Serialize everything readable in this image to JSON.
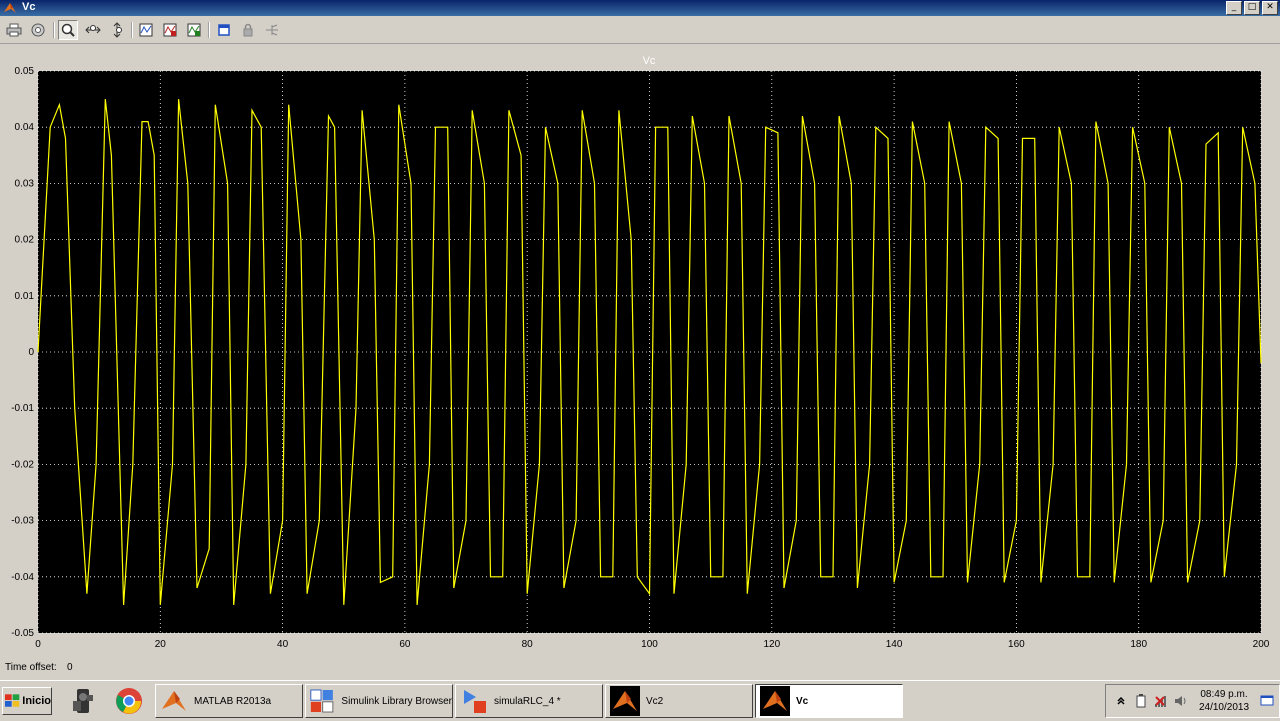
{
  "window": {
    "title": "Vc"
  },
  "plot": {
    "title": "Vc",
    "colors": {
      "background": "#000000",
      "grid": "#ffffff",
      "line": "#ffff00",
      "axes": "#ffffff"
    }
  },
  "chart_data": {
    "type": "line",
    "title": "Vc",
    "xlabel": "",
    "ylabel": "",
    "xlim": [
      0,
      200
    ],
    "ylim": [
      -0.05,
      0.05
    ],
    "grid": true,
    "x_ticks": [
      "0",
      "20",
      "40",
      "60",
      "80",
      "100",
      "120",
      "140",
      "160",
      "180",
      "200"
    ],
    "y_ticks": [
      "0.05",
      "0.04",
      "0.03",
      "0.02",
      "0.01",
      "0",
      "-0.01",
      "-0.02",
      "-0.03",
      "-0.04",
      "-0.05"
    ],
    "series": [
      {
        "color": "#ffff00",
        "x": [
          0,
          2,
          3.5,
          4.5,
          6,
          8,
          9.5,
          11,
          12,
          14,
          15.5,
          17,
          18,
          19,
          20,
          22,
          23,
          24.5,
          26,
          28,
          29,
          31,
          32,
          34,
          35,
          36.5,
          38,
          40,
          41,
          43,
          44,
          46,
          47.5,
          48.5,
          50,
          52,
          53,
          55,
          56,
          58,
          59,
          61,
          62,
          64,
          65,
          67,
          68,
          70,
          71,
          73,
          74,
          76,
          77,
          79,
          80,
          82,
          83,
          85,
          86,
          88,
          89,
          91,
          92,
          94,
          95,
          97,
          98,
          100,
          101,
          103,
          104,
          106,
          107,
          109,
          110,
          112,
          113,
          115,
          116,
          118,
          119,
          121,
          122,
          124,
          125,
          127,
          128,
          130,
          131,
          133,
          134,
          136,
          137,
          139,
          140,
          142,
          143,
          145,
          146,
          148,
          149,
          151,
          152,
          154,
          155,
          157,
          158,
          160,
          161,
          163,
          164,
          166,
          167,
          169,
          170,
          172,
          173,
          175,
          176,
          178,
          179,
          181,
          182,
          184,
          185,
          187,
          188,
          190,
          191,
          193,
          194,
          196,
          197,
          199,
          200
        ],
        "y": [
          0,
          0.04,
          0.044,
          0.038,
          -0.01,
          -0.043,
          -0.02,
          0.045,
          0.035,
          -0.045,
          -0.02,
          0.041,
          0.041,
          0.035,
          -0.045,
          -0.02,
          0.045,
          0.03,
          -0.042,
          -0.035,
          0.044,
          0.03,
          -0.045,
          -0.02,
          0.043,
          0.04,
          -0.043,
          -0.03,
          0.044,
          0.02,
          -0.043,
          -0.03,
          0.042,
          0.04,
          -0.045,
          -0.01,
          0.043,
          0.02,
          -0.041,
          -0.04,
          0.044,
          0.03,
          -0.045,
          -0.02,
          0.04,
          0.04,
          -0.042,
          -0.03,
          0.043,
          0.03,
          -0.04,
          -0.04,
          0.043,
          0.035,
          -0.043,
          -0.02,
          0.04,
          0.03,
          -0.042,
          -0.03,
          0.043,
          0.03,
          -0.04,
          -0.04,
          0.043,
          0.02,
          -0.04,
          -0.043,
          0.04,
          0.04,
          -0.043,
          -0.02,
          0.042,
          0.03,
          -0.04,
          -0.04,
          0.042,
          0.03,
          -0.043,
          -0.02,
          0.04,
          0.039,
          -0.042,
          -0.03,
          0.042,
          0.03,
          -0.04,
          -0.04,
          0.042,
          0.03,
          -0.042,
          -0.02,
          0.04,
          0.038,
          -0.041,
          -0.03,
          0.041,
          0.03,
          -0.04,
          -0.04,
          0.041,
          0.03,
          -0.041,
          -0.02,
          0.04,
          0.038,
          -0.041,
          -0.03,
          0.038,
          0.038,
          -0.041,
          -0.02,
          0.04,
          0.03,
          -0.04,
          -0.04,
          0.041,
          0.03,
          -0.041,
          -0.02,
          0.04,
          0.03,
          -0.041,
          -0.03,
          0.04,
          0.03,
          -0.041,
          -0.03,
          0.037,
          0.039,
          -0.04,
          -0.02,
          0.04,
          0.03,
          -0.002
        ]
      }
    ]
  },
  "status": {
    "time_offset_label": "Time offset:",
    "time_offset_value": "0"
  },
  "taskbar": {
    "start_label": "Inicio",
    "tasks": [
      {
        "label": "MATLAB R2013a"
      },
      {
        "label": "Simulink Library Browser"
      },
      {
        "label": "simulaRLC_4 *"
      },
      {
        "label": "Vc2"
      },
      {
        "label": "Vc"
      }
    ],
    "clock_time": "08:49 p.m.",
    "clock_date": "24/10/2013"
  },
  "icons": [
    "print-icon",
    "parameters-icon",
    "zoom-icon",
    "zoom-x-icon",
    "zoom-y-icon",
    "autoscale-icon",
    "save-axes-icon",
    "restore-axes-icon",
    "float-icon",
    "lock-icon",
    "signal-selection-icon"
  ]
}
